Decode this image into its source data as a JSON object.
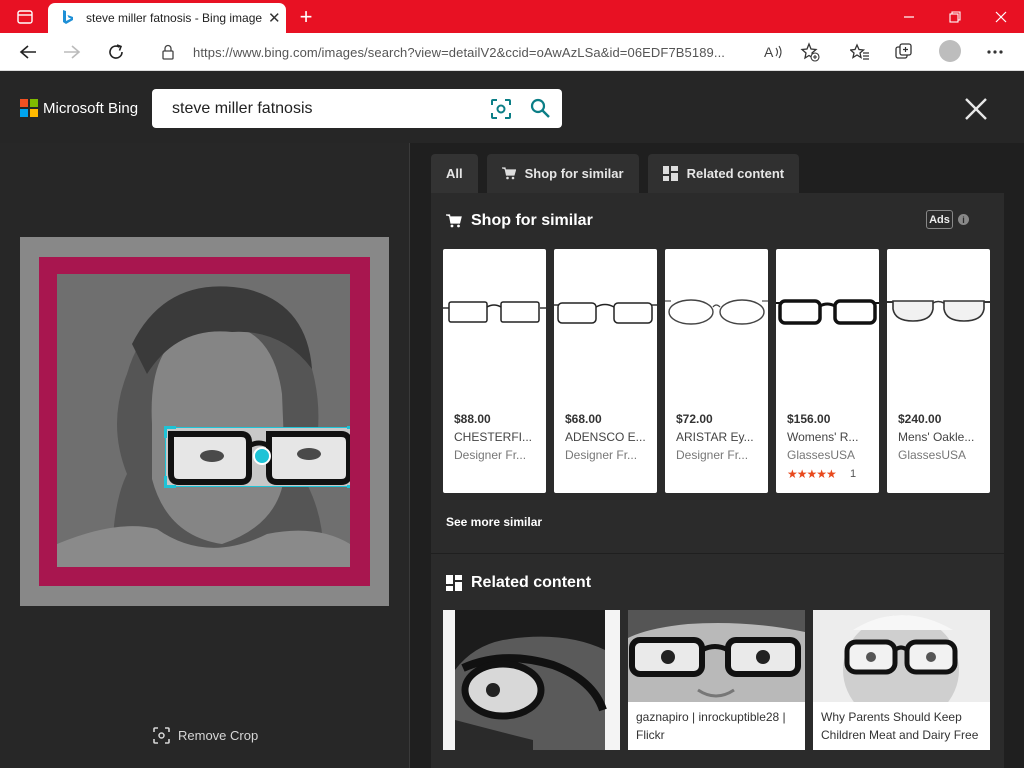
{
  "browser": {
    "tab_title": "steve miller fatnosis - Bing image",
    "url": "https://www.bing.com/images/search?view=detailV2&ccid=oAwAzLSa&id=06EDF7B5189..."
  },
  "bing": {
    "brand": "Microsoft Bing",
    "query": "steve miller fatnosis"
  },
  "left": {
    "remove_crop": "Remove Crop"
  },
  "tabs": [
    {
      "label": "All"
    },
    {
      "label": "Shop for similar"
    },
    {
      "label": "Related content"
    }
  ],
  "shop": {
    "heading": "Shop for similar",
    "ads_label": "Ads",
    "info_glyph": "i",
    "see_more": "See more similar",
    "products": [
      {
        "price": "$88.00",
        "title": "CHESTERFI...",
        "seller": "Designer Fr..."
      },
      {
        "price": "$68.00",
        "title": "ADENSCO E...",
        "seller": "Designer Fr..."
      },
      {
        "price": "$72.00",
        "title": "ARISTAR Ey...",
        "seller": "Designer Fr..."
      },
      {
        "price": "$156.00",
        "title": "Womens' R...",
        "seller": "GlassesUSA",
        "stars": "★★★★★",
        "rating_count": "1"
      },
      {
        "price": "$240.00",
        "title": "Mens' Oakle...",
        "seller": "GlassesUSA"
      }
    ]
  },
  "related": {
    "heading": "Related content",
    "items": [
      {
        "caption": ""
      },
      {
        "caption": "gaznapiro | inrockuptible28 | Flickr"
      },
      {
        "caption": "Why Parents Should Keep Children Meat and Dairy Free"
      }
    ]
  },
  "colors": {
    "titlebar": "#e81123",
    "accent_cyan": "#1fc3d6",
    "mat": "#a8164f"
  }
}
